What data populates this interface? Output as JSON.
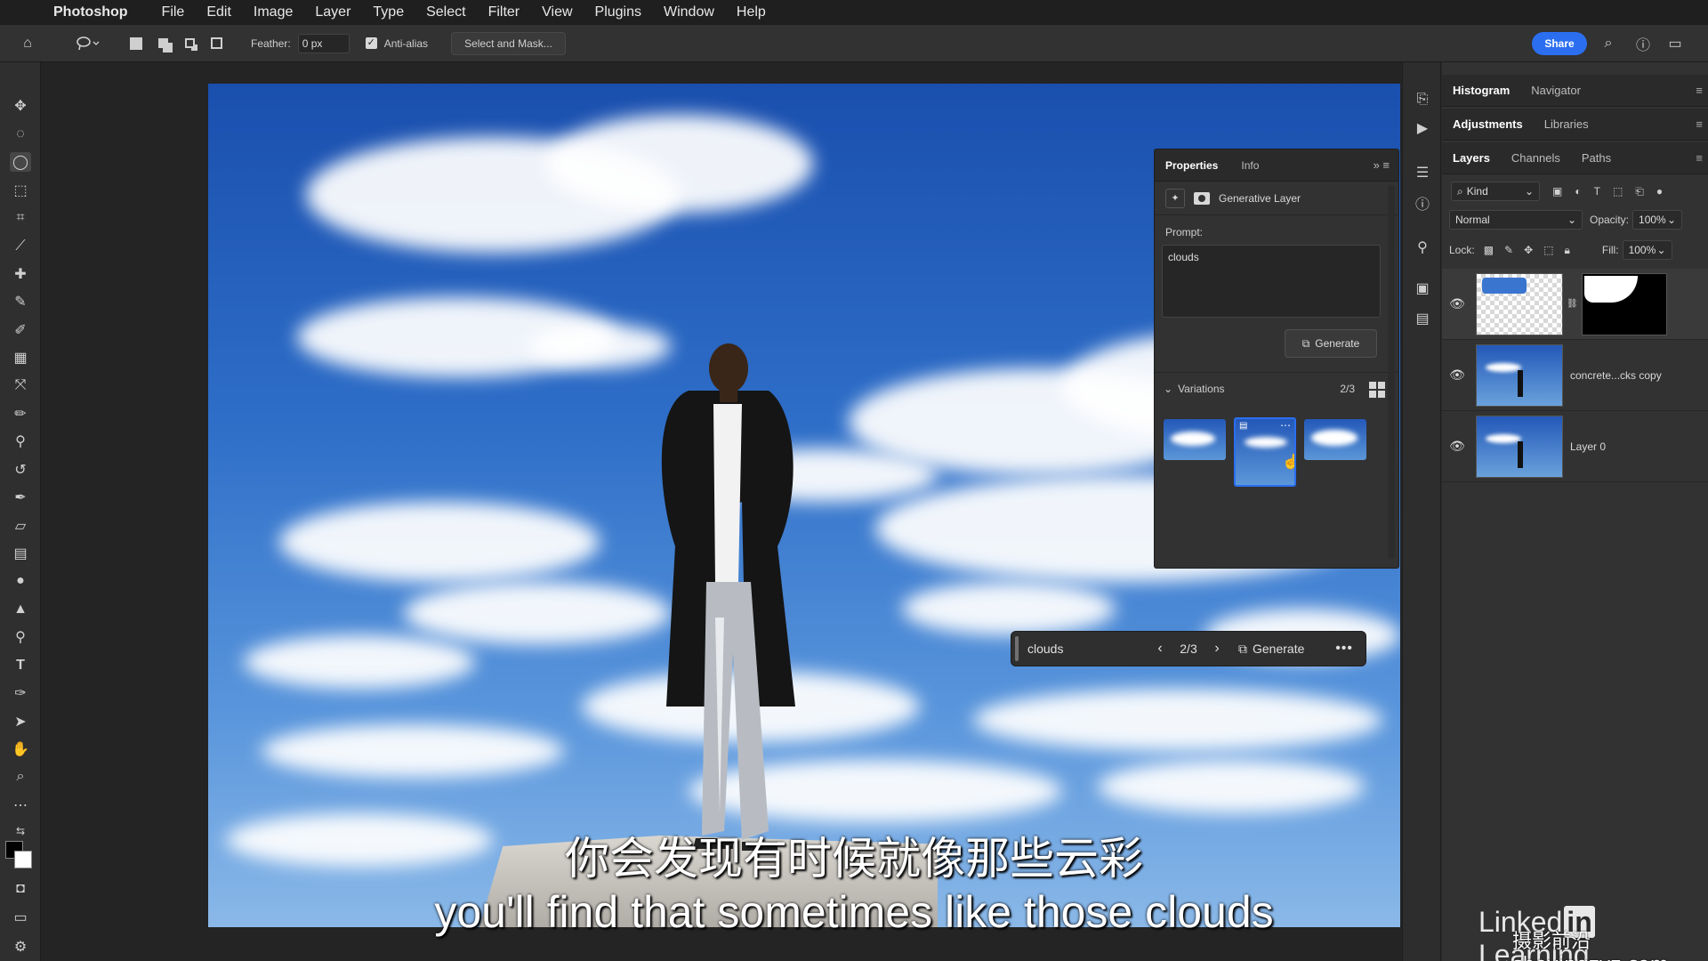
{
  "app": {
    "name": "Photoshop"
  },
  "menu": [
    "File",
    "Edit",
    "Image",
    "Layer",
    "Type",
    "Select",
    "Filter",
    "View",
    "Plugins",
    "Window",
    "Help"
  ],
  "options": {
    "feather_label": "Feather:",
    "feather_value": "0 px",
    "anti_alias_label": "Anti-alias",
    "anti_alias_checked": true,
    "select_mask_label": "Select and Mask...",
    "share_label": "Share"
  },
  "properties": {
    "tabs": [
      "Properties",
      "Info"
    ],
    "layer_type": "Generative Layer",
    "prompt_label": "Prompt:",
    "prompt_value": "clouds",
    "generate_label": "Generate",
    "variations_label": "Variations",
    "variations_count": "2/3"
  },
  "taskbar": {
    "prompt": "clouds",
    "count": "2/3",
    "generate_label": "Generate"
  },
  "panels": {
    "top_tabs": [
      "Histogram",
      "Navigator"
    ],
    "mid_tabs": [
      "Adjustments",
      "Libraries"
    ],
    "layer_tabs": [
      "Layers",
      "Channels",
      "Paths"
    ],
    "kind_label": "Kind",
    "blend_mode": "Normal",
    "opacity_label": "Opacity:",
    "opacity_value": "100%",
    "lock_label": "Lock:",
    "fill_label": "Fill:",
    "fill_value": "100%"
  },
  "layers": [
    {
      "name": "",
      "visible": true,
      "selected": true
    },
    {
      "name": "concrete...cks copy",
      "visible": true,
      "selected": false
    },
    {
      "name": "Layer 0",
      "visible": true,
      "selected": false
    }
  ],
  "captions": {
    "zh": "你会发现有时候就像那些云彩",
    "en": "you'll find that sometimes like those clouds"
  },
  "branding": {
    "logo_left": "Linked",
    "logo_in": "in",
    "logo_right": " Learning",
    "watermark": "摄影前沿 sheyingzyz.com"
  },
  "colors": {
    "accent": "#2b6ff0",
    "sky": "#2e6ec8"
  }
}
